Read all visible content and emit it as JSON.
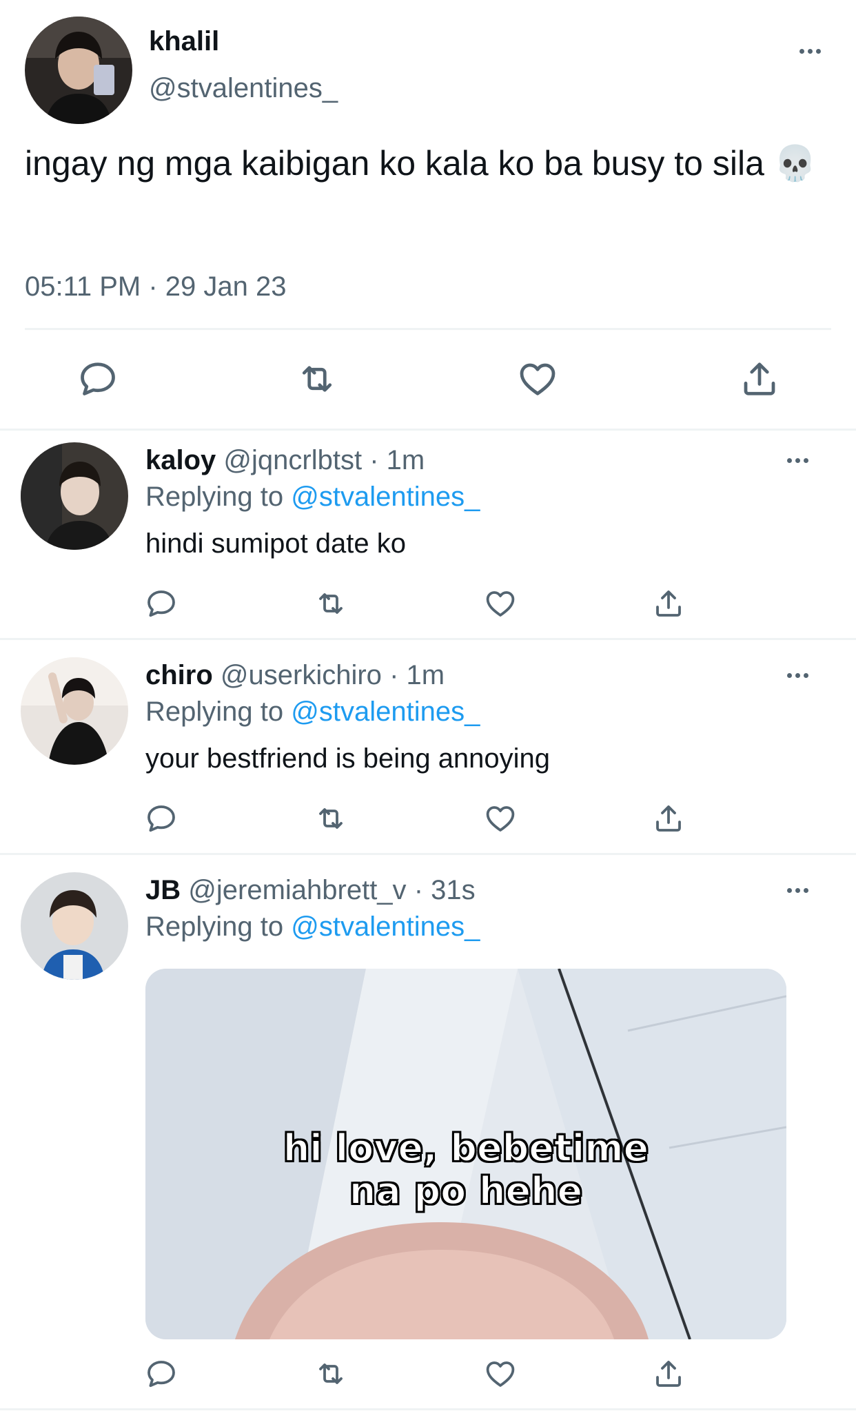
{
  "main_tweet": {
    "display_name": "khalil",
    "handle": "@stvalentines_",
    "text": "ingay ng mga kaibigan ko kala ko ba busy to sila 💀",
    "timestamp": "05:11 PM · 29 Jan 23",
    "icons": [
      "reply-icon",
      "retweet-icon",
      "like-icon",
      "share-icon",
      "more-icon"
    ]
  },
  "replies": [
    {
      "display_name": "kaloy",
      "handle": "@jqncrlbtst",
      "time": "· 1m",
      "replying_prefix": "Replying to",
      "replying_to": "@stvalentines_",
      "text": "hindi sumipot date ko"
    },
    {
      "display_name": "chiro",
      "handle": "@userkichiro",
      "time": "· 1m",
      "replying_prefix": "Replying to",
      "replying_to": "@stvalentines_",
      "text": "your bestfriend is being annoying"
    },
    {
      "display_name": "JB",
      "handle": "@jeremiahbrett_v",
      "time": "· 31s",
      "replying_prefix": "Replying to",
      "replying_to": "@stvalentines_",
      "media_caption_line1": "hi love, bebetime",
      "media_caption_line2": "na po hehe"
    }
  ],
  "colors": {
    "link": "#1d9bf0",
    "secondary_text": "#536471",
    "divider": "#eff3f4"
  }
}
